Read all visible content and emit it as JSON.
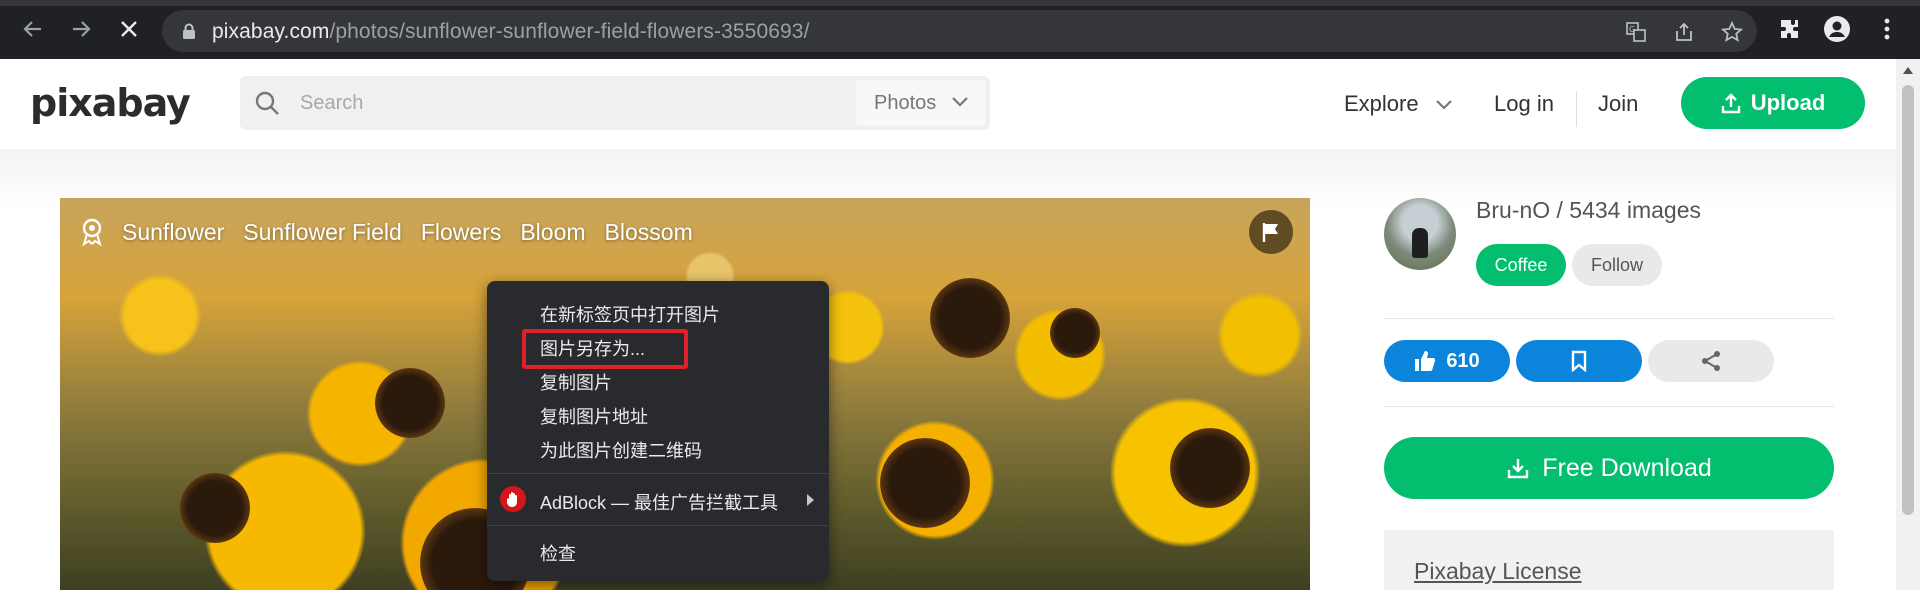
{
  "browser": {
    "url_host": "pixabay.com",
    "url_path": "/photos/sunflower-sunflower-field-flowers-3550693/"
  },
  "header": {
    "logo": "pixabay",
    "search_placeholder": "Search",
    "search_filter": "Photos",
    "explore": "Explore",
    "login": "Log in",
    "join": "Join",
    "upload": "Upload"
  },
  "photo": {
    "tags": [
      "Sunflower",
      "Sunflower Field",
      "Flowers",
      "Bloom",
      "Blossom"
    ]
  },
  "context_menu": {
    "items": [
      "在新标签页中打开图片",
      "图片另存为...",
      "复制图片",
      "复制图片地址",
      "为此图片创建二维码"
    ],
    "adblock": "AdBlock — 最佳广告拦截工具",
    "inspect": "检查"
  },
  "sidebar": {
    "author": "Bru-nO / 5434 images",
    "coffee": "Coffee",
    "follow": "Follow",
    "likes": "610",
    "download": "Free Download",
    "license": "Pixabay License"
  },
  "colors": {
    "brand_green": "#02be6e",
    "action_blue": "#0b84dc",
    "highlight_red": "#e0202a"
  }
}
